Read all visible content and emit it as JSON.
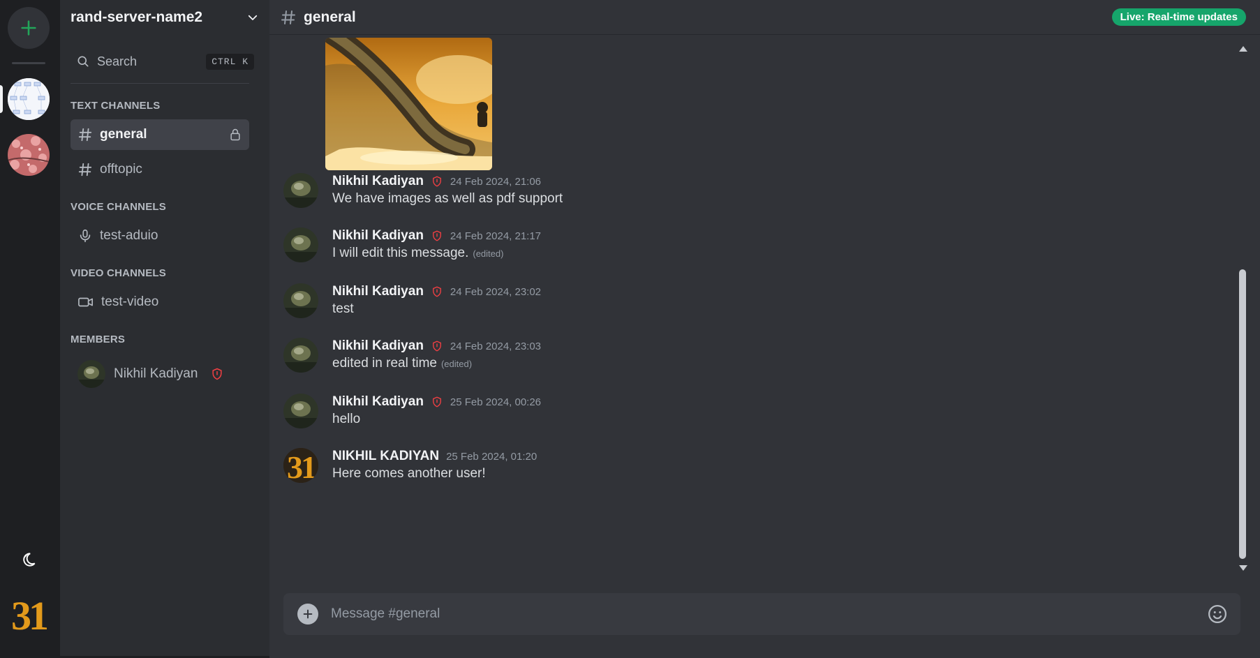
{
  "server": {
    "name": "rand-server-name2"
  },
  "search": {
    "label": "Search",
    "shortcut": "CTRL K"
  },
  "sections": {
    "text": "TEXT CHANNELS",
    "voice": "VOICE CHANNELS",
    "video": "VIDEO CHANNELS",
    "members": "MEMBERS"
  },
  "channels": {
    "text": [
      {
        "name": "general",
        "active": true,
        "locked": true
      },
      {
        "name": "offtopic",
        "active": false
      }
    ],
    "voice": [
      {
        "name": "test-aduio"
      }
    ],
    "video": [
      {
        "name": "test-video"
      }
    ]
  },
  "members": [
    {
      "name": "Nikhil Kadiyan",
      "role_icon": "shield-icon"
    }
  ],
  "chat": {
    "title": "general",
    "live_badge": "Live: Real-time updates",
    "composer_placeholder": "Message #general"
  },
  "messages": [
    {
      "author": "Nikhil Kadiyan",
      "moderator": true,
      "time": "24 Feb 2024, 21:06",
      "text": "We have images as well as pdf support",
      "edited": ""
    },
    {
      "author": "Nikhil Kadiyan",
      "moderator": true,
      "time": "24 Feb 2024, 21:17",
      "text": "I will edit this message.",
      "edited": "(edited)"
    },
    {
      "author": "Nikhil Kadiyan",
      "moderator": true,
      "time": "24 Feb 2024, 23:02",
      "text": "test",
      "edited": ""
    },
    {
      "author": "Nikhil Kadiyan",
      "moderator": true,
      "time": "24 Feb 2024, 23:03",
      "text": "edited in real time",
      "edited": "(edited)"
    },
    {
      "author": "Nikhil Kadiyan",
      "moderator": true,
      "time": "25 Feb 2024, 00:26",
      "text": "hello",
      "edited": ""
    },
    {
      "author": "NIKHIL KADIYAN",
      "moderator": false,
      "time": "25 Feb 2024, 01:20",
      "text": "Here comes another user!",
      "edited": ""
    }
  ],
  "colors": {
    "accent_green": "#23a55a",
    "live_badge": "#16a56b",
    "moderator_red": "#f23f43"
  },
  "icons": {
    "add_server": "plus-icon",
    "channel": "hashtag-icon",
    "lock": "lock-icon",
    "voice": "microphone-icon",
    "video": "video-camera-icon",
    "theme": "moon-icon",
    "emoji": "smiley-icon"
  }
}
